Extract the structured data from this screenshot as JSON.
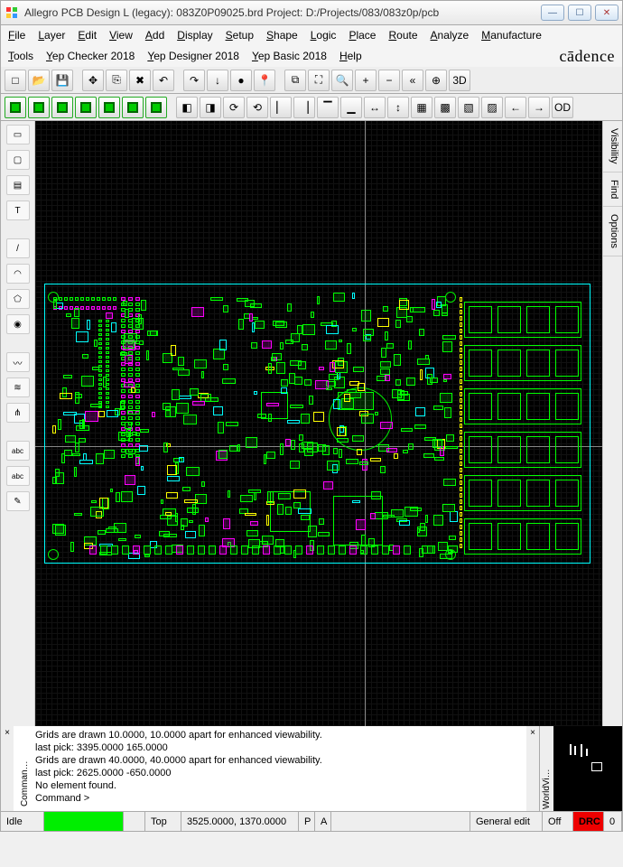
{
  "window": {
    "title": "Allegro PCB Design L (legacy): 083Z0P09025.brd  Project: D:/Projects/083/083z0p/pcb"
  },
  "menu1": [
    "File",
    "Layer",
    "Edit",
    "View",
    "Add",
    "Display",
    "Setup",
    "Shape",
    "Logic",
    "Place",
    "Route",
    "Analyze",
    "Manufacture"
  ],
  "menu2": [
    "Tools",
    "Yep Checker 2018",
    "Yep Designer 2018",
    "Yep Basic 2018",
    "Help"
  ],
  "brand": "cādence",
  "toolbar1": {
    "items": [
      "new",
      "open",
      "save",
      "move",
      "copy",
      "delete",
      "undo",
      "redo",
      "pin",
      "check",
      "bookmark",
      "zoom-window",
      "zoom-fit",
      "zoom-refresh",
      "zoom-in",
      "zoom-out",
      "zoom-prev",
      "zoom-center",
      "3d"
    ]
  },
  "toolbar2": {
    "green_items": [
      "g1",
      "g2",
      "g3",
      "g4",
      "g5",
      "g6",
      "g7"
    ],
    "mid_items": [
      "flip-h",
      "flip-v",
      "rotate-cw",
      "rotate-ccw",
      "align-l",
      "align-r",
      "align-t",
      "align-b",
      "dist-h",
      "dist-v",
      "group1",
      "group2",
      "group3",
      "group4",
      "move-l",
      "move-r",
      "odb"
    ]
  },
  "left_tools": [
    "select",
    "rect",
    "comp",
    "text",
    "",
    "line",
    "arc",
    "poly",
    "via",
    "",
    "trace",
    "diff",
    "fanout",
    "",
    "abc-add",
    "abc-edit",
    "pencil"
  ],
  "right_tabs": [
    "Visibility",
    "Find",
    "Options"
  ],
  "log": {
    "label": "Comman…",
    "lines": [
      "Grids are drawn 10.0000, 10.0000 apart for enhanced viewability.",
      "last pick:  3395.0000 165.0000",
      "Grids are drawn 40.0000, 40.0000 apart for enhanced viewability.",
      "last pick:  2625.0000 -650.0000",
      "No element found.",
      "Command >"
    ]
  },
  "worldview_label": "WorldVi…",
  "status": {
    "idle": "Idle",
    "layer": "Top",
    "coords": "3525.0000, 1370.0000",
    "p": "P",
    "a": "A",
    "mode": "General edit",
    "off": "Off",
    "drc": "DRC",
    "count": "0"
  }
}
